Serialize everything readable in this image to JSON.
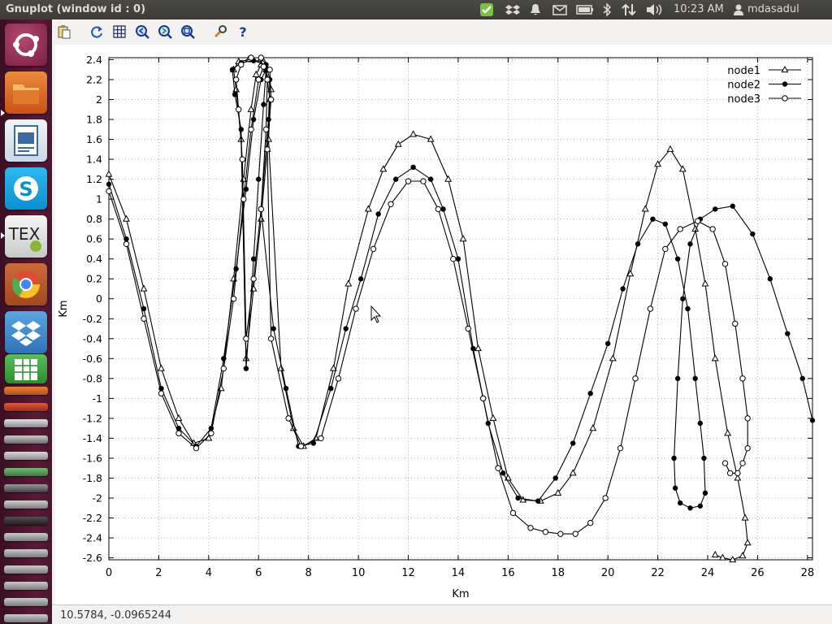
{
  "window": {
    "title": "Gnuplot (window id : 0)"
  },
  "tray": {
    "clock": "10:23 AM",
    "user": "mdasadul"
  },
  "launcher": {
    "apps": [
      "ubuntu-dash",
      "files",
      "libreoffice-impress",
      "skype",
      "texmaker",
      "chromium",
      "dropbox",
      "libreoffice-calc"
    ]
  },
  "toolbar": {
    "buttons": [
      "clipboard",
      "replot",
      "grid",
      "zoom-previous",
      "zoom-next",
      "unzoom",
      "preferences",
      "help"
    ]
  },
  "status": {
    "coords": "10.5784, -0.0965244"
  },
  "colors": {
    "panel": "#3c3b37",
    "launcher": "#4a1530",
    "plot_bg": "#ffffff",
    "series": "#000000"
  },
  "chart_data": {
    "type": "line",
    "xlabel": "Km",
    "ylabel": "Km",
    "xlim": [
      0,
      28.2
    ],
    "ylim": [
      -2.62,
      2.42
    ],
    "grid": true,
    "legend": "top-right",
    "x_ticks": [
      0,
      2,
      4,
      6,
      8,
      10,
      12,
      14,
      16,
      18,
      20,
      22,
      24,
      26,
      28
    ],
    "y_ticks": [
      2.4,
      2.2,
      2,
      1.8,
      1.6,
      1.4,
      1.2,
      1,
      0.8,
      0.6,
      0.4,
      0.2,
      0,
      -0.2,
      -0.4,
      -0.6,
      -0.8,
      -1,
      -1.2,
      -1.4,
      -1.6,
      -1.8,
      -2,
      -2.2,
      -2.4,
      -2.6
    ],
    "series": [
      {
        "name": "node1",
        "marker": "triangle",
        "points": [
          [
            0,
            1.25
          ],
          [
            0.7,
            0.8
          ],
          [
            1.4,
            0.1
          ],
          [
            2.1,
            -0.7
          ],
          [
            2.8,
            -1.2
          ],
          [
            3.4,
            -1.45
          ],
          [
            4,
            -1.4
          ],
          [
            4.5,
            -0.9
          ],
          [
            5,
            0.2
          ],
          [
            5.4,
            1.2
          ],
          [
            5.7,
            1.9
          ],
          [
            5.9,
            2.25
          ],
          [
            6.1,
            2.35
          ],
          [
            6.3,
            2.3
          ],
          [
            6.45,
            2.0
          ],
          [
            6.35,
            1.5
          ],
          [
            6.1,
            0.8
          ],
          [
            5.8,
            0.1
          ],
          [
            5.5,
            -0.6
          ],
          [
            5.3,
            1.6
          ],
          [
            5.1,
            2.1
          ],
          [
            5,
            2.3
          ],
          [
            5.2,
            2.38
          ],
          [
            5.6,
            2.4
          ],
          [
            6.2,
            2.38
          ],
          [
            6.5,
            2.1
          ],
          [
            6.4,
            1.6
          ],
          [
            6.9,
            -0.7
          ],
          [
            7.4,
            -1.3
          ],
          [
            7.8,
            -1.48
          ],
          [
            8.3,
            -1.4
          ],
          [
            9,
            -0.7
          ],
          [
            9.6,
            0.15
          ],
          [
            10.4,
            0.9
          ],
          [
            11,
            1.3
          ],
          [
            11.6,
            1.55
          ],
          [
            12.2,
            1.65
          ],
          [
            12.9,
            1.6
          ],
          [
            13.6,
            1.2
          ],
          [
            14.2,
            0.6
          ],
          [
            14.8,
            -0.5
          ],
          [
            15.4,
            -1.2
          ],
          [
            16,
            -1.8
          ],
          [
            16.6,
            -2.02
          ],
          [
            17.3,
            -2.03
          ],
          [
            18,
            -1.95
          ],
          [
            18.6,
            -1.75
          ],
          [
            19.4,
            -1.3
          ],
          [
            20.2,
            -0.6
          ],
          [
            20.9,
            0.25
          ],
          [
            21.5,
            0.9
          ],
          [
            22,
            1.35
          ],
          [
            22.5,
            1.5
          ],
          [
            23,
            1.3
          ],
          [
            23.5,
            0.7
          ],
          [
            23.9,
            0.15
          ],
          [
            24.3,
            -0.6
          ],
          [
            24.8,
            -1.35
          ],
          [
            25.2,
            -1.8
          ],
          [
            25.5,
            -2.2
          ],
          [
            25.6,
            -2.45
          ],
          [
            25.4,
            -2.58
          ],
          [
            25,
            -2.62
          ],
          [
            24.6,
            -2.6
          ],
          [
            24.3,
            -2.57
          ]
        ]
      },
      {
        "name": "node2",
        "marker": "filled-circle",
        "points": [
          [
            0,
            1.15
          ],
          [
            0.7,
            0.6
          ],
          [
            1.4,
            -0.1
          ],
          [
            2.1,
            -0.9
          ],
          [
            2.8,
            -1.3
          ],
          [
            3.5,
            -1.48
          ],
          [
            4.1,
            -1.3
          ],
          [
            4.6,
            -0.6
          ],
          [
            5.1,
            0.3
          ],
          [
            5.5,
            1.1
          ],
          [
            5.8,
            1.8
          ],
          [
            6.1,
            2.2
          ],
          [
            6.3,
            2.3
          ],
          [
            6.2,
            1.95
          ],
          [
            6.0,
            1.2
          ],
          [
            5.8,
            0.4
          ],
          [
            5.5,
            -0.7
          ],
          [
            5.3,
            1.7
          ],
          [
            5.05,
            2.05
          ],
          [
            4.95,
            2.3
          ],
          [
            5.3,
            2.37
          ],
          [
            5.8,
            2.39
          ],
          [
            6.3,
            2.35
          ],
          [
            6.45,
            2.2
          ],
          [
            6.4,
            1.8
          ],
          [
            6.1,
            0.9
          ],
          [
            6.6,
            -0.3
          ],
          [
            7.1,
            -0.9
          ],
          [
            7.6,
            -1.48
          ],
          [
            8.2,
            -1.45
          ],
          [
            8.9,
            -0.9
          ],
          [
            9.5,
            -0.3
          ],
          [
            10.1,
            0.2
          ],
          [
            10.8,
            0.85
          ],
          [
            11.5,
            1.2
          ],
          [
            12.2,
            1.32
          ],
          [
            12.9,
            1.2
          ],
          [
            13.4,
            0.9
          ],
          [
            14,
            0.4
          ],
          [
            14.6,
            -0.5
          ],
          [
            15.2,
            -1.25
          ],
          [
            15.8,
            -1.75
          ],
          [
            16.4,
            -2.0
          ],
          [
            17.2,
            -2.03
          ],
          [
            17.9,
            -1.8
          ],
          [
            18.6,
            -1.45
          ],
          [
            19.3,
            -0.95
          ],
          [
            20,
            -0.45
          ],
          [
            20.6,
            0.1
          ],
          [
            21.2,
            0.55
          ],
          [
            21.8,
            0.8
          ],
          [
            22.3,
            0.75
          ],
          [
            22.8,
            0.4
          ],
          [
            23.2,
            -0.1
          ],
          [
            23.5,
            -0.8
          ],
          [
            23.7,
            -1.25
          ],
          [
            23.85,
            -1.6
          ],
          [
            23.9,
            -1.95
          ],
          [
            23.7,
            -2.08
          ],
          [
            23.3,
            -2.1
          ],
          [
            22.9,
            -2.05
          ],
          [
            22.7,
            -1.9
          ],
          [
            22.65,
            -1.6
          ],
          [
            22.8,
            -0.8
          ],
          [
            23,
            0.0
          ],
          [
            23.3,
            0.55
          ],
          [
            23.7,
            0.8
          ],
          [
            24.3,
            0.9
          ],
          [
            25,
            0.93
          ],
          [
            25.8,
            0.65
          ],
          [
            26.5,
            0.2
          ],
          [
            27.2,
            -0.35
          ],
          [
            27.8,
            -0.8
          ],
          [
            28.2,
            -1.22
          ]
        ]
      },
      {
        "name": "node3",
        "marker": "open-circle",
        "points": [
          [
            0,
            1.08
          ],
          [
            0.7,
            0.55
          ],
          [
            1.4,
            -0.2
          ],
          [
            2.1,
            -0.95
          ],
          [
            2.8,
            -1.35
          ],
          [
            3.5,
            -1.5
          ],
          [
            4.1,
            -1.35
          ],
          [
            4.6,
            -0.7
          ],
          [
            5.0,
            0.0
          ],
          [
            5.4,
            1.0
          ],
          [
            5.7,
            1.7
          ],
          [
            6.0,
            2.2
          ],
          [
            6.2,
            2.33
          ],
          [
            6.35,
            2.2
          ],
          [
            6.3,
            1.7
          ],
          [
            6.1,
            0.9
          ],
          [
            5.8,
            0.2
          ],
          [
            5.5,
            -0.4
          ],
          [
            5.35,
            1.4
          ],
          [
            5.2,
            1.9
          ],
          [
            5.1,
            2.2
          ],
          [
            5.3,
            2.35
          ],
          [
            5.7,
            2.42
          ],
          [
            6.1,
            2.42
          ],
          [
            6.45,
            2.3
          ],
          [
            6.5,
            2.0
          ],
          [
            6.35,
            1.5
          ],
          [
            6.5,
            -0.4
          ],
          [
            7.2,
            -1.2
          ],
          [
            7.7,
            -1.48
          ],
          [
            8.5,
            -1.4
          ],
          [
            9.2,
            -0.8
          ],
          [
            9.9,
            -0.1
          ],
          [
            10.6,
            0.5
          ],
          [
            11.3,
            0.95
          ],
          [
            12,
            1.18
          ],
          [
            12.6,
            1.18
          ],
          [
            13.2,
            0.9
          ],
          [
            13.8,
            0.4
          ],
          [
            14.4,
            -0.3
          ],
          [
            15,
            -1.0
          ],
          [
            15.6,
            -1.7
          ],
          [
            16.2,
            -2.15
          ],
          [
            16.9,
            -2.3
          ],
          [
            17.5,
            -2.34
          ],
          [
            18.1,
            -2.36
          ],
          [
            18.7,
            -2.36
          ],
          [
            19.3,
            -2.25
          ],
          [
            19.9,
            -2.0
          ],
          [
            20.5,
            -1.5
          ],
          [
            21.1,
            -0.8
          ],
          [
            21.7,
            -0.1
          ],
          [
            22.3,
            0.5
          ],
          [
            22.9,
            0.7
          ],
          [
            23.6,
            0.78
          ],
          [
            24.2,
            0.7
          ],
          [
            24.7,
            0.35
          ],
          [
            25.1,
            -0.25
          ],
          [
            25.4,
            -0.8
          ],
          [
            25.6,
            -1.2
          ],
          [
            25.6,
            -1.5
          ],
          [
            25.4,
            -1.65
          ],
          [
            25.2,
            -1.75
          ],
          [
            24.9,
            -1.75
          ],
          [
            24.7,
            -1.65
          ]
        ]
      }
    ]
  }
}
